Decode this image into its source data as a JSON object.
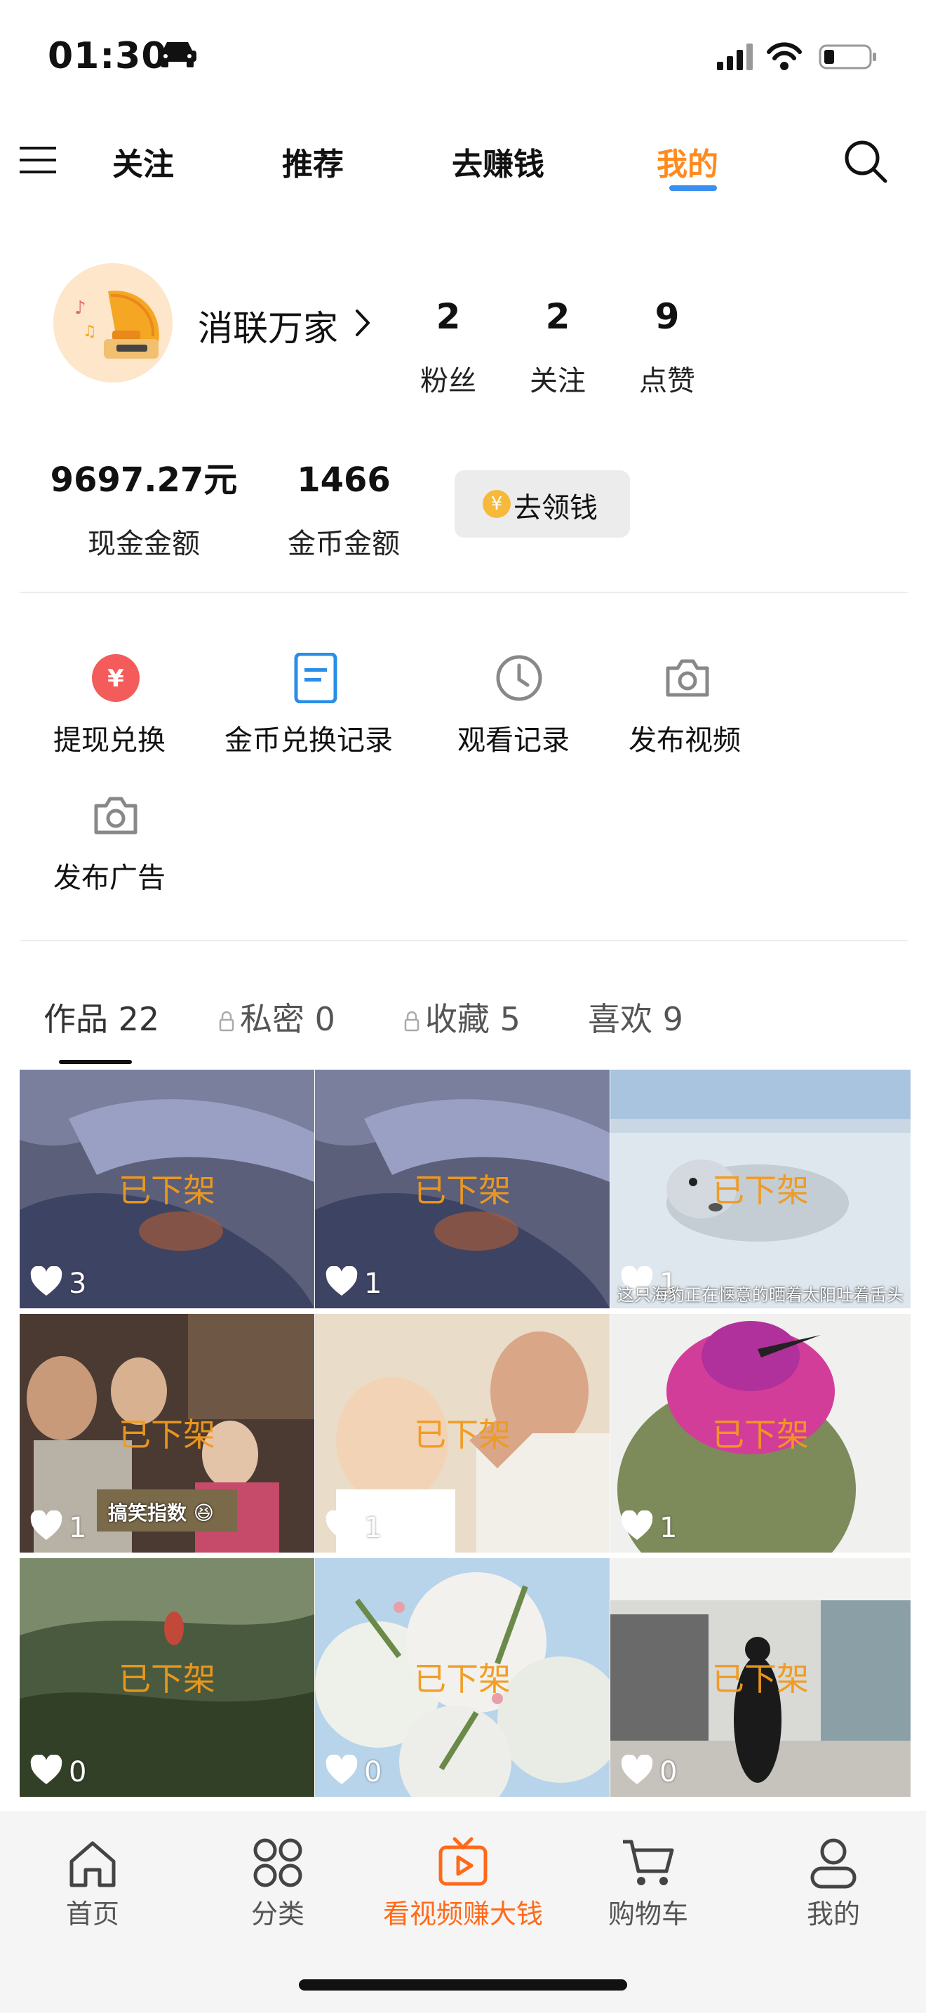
{
  "status_bar": {
    "time": "01:30"
  },
  "top_nav": {
    "tabs": [
      {
        "label": "关注"
      },
      {
        "label": "推荐"
      },
      {
        "label": "去赚钱"
      },
      {
        "label": "我的",
        "active": true
      }
    ]
  },
  "profile": {
    "username": "消联万家",
    "stats": [
      {
        "value": "2",
        "label": "粉丝"
      },
      {
        "value": "2",
        "label": "关注"
      },
      {
        "value": "9",
        "label": "点赞"
      }
    ],
    "cash": {
      "value": "9697.27元",
      "label": "现金金额"
    },
    "coins": {
      "value": "1466",
      "label": "金币金额"
    },
    "claim_button": "去领钱",
    "claim_coin_symbol": "¥"
  },
  "functions": [
    {
      "label": "提现兑换",
      "icon": "yuan-circle-icon"
    },
    {
      "label": "金币兑换记录",
      "icon": "document-icon"
    },
    {
      "label": "观看记录",
      "icon": "clock-icon"
    },
    {
      "label": "发布视频",
      "icon": "camera-icon"
    },
    {
      "label": "发布广告",
      "icon": "camera-icon"
    }
  ],
  "content_tabs": [
    {
      "label": "作品 22",
      "active": true,
      "locked": false
    },
    {
      "label": "私密 0",
      "locked": true
    },
    {
      "label": "收藏 5",
      "locked": true
    },
    {
      "label": "喜欢 9",
      "locked": false
    }
  ],
  "videos": [
    {
      "status": "已下架",
      "likes": "3"
    },
    {
      "status": "已下架",
      "likes": "1"
    },
    {
      "status": "已下架",
      "likes": "1",
      "caption": "这只海豹正在惬意的晒着太阳吐着舌头"
    },
    {
      "status": "已下架",
      "likes": "1",
      "badge": "搞笑指数"
    },
    {
      "status": "已下架",
      "likes": "1"
    },
    {
      "status": "已下架",
      "likes": "1"
    },
    {
      "status": "已下架",
      "likes": "0"
    },
    {
      "status": "已下架",
      "likes": "0"
    },
    {
      "status": "已下架",
      "likes": "0"
    }
  ],
  "tab_bar": [
    {
      "label": "首页",
      "icon": "home-icon"
    },
    {
      "label": "分类",
      "icon": "grid-icon"
    },
    {
      "label": "看视频赚大钱",
      "icon": "tv-play-icon",
      "active": true
    },
    {
      "label": "购物车",
      "icon": "cart-icon"
    },
    {
      "label": "我的",
      "icon": "user-icon"
    }
  ],
  "colors": {
    "accent": "#ff8a1e",
    "active_tab": "#ff6a1a",
    "nav_underline": "#3a8ff0",
    "removed_label": "#f29a1c"
  }
}
